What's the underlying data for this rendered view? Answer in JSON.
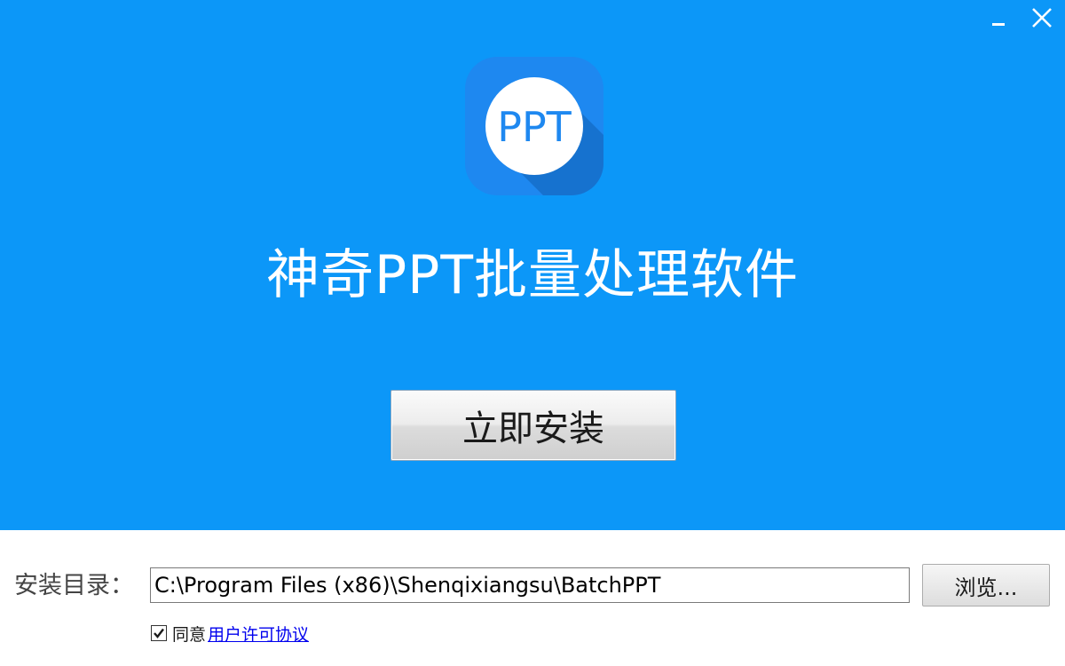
{
  "window": {
    "title": "神奇PPT批量处理软件",
    "minimize_icon": "minimize-icon",
    "close_icon": "close-icon"
  },
  "logo": {
    "text": "PPT",
    "icon": "ppt-app-logo"
  },
  "install_button": {
    "label": "立即安装"
  },
  "install_dir": {
    "label": "安装目录：",
    "value": "C:\\Program Files (x86)\\Shenqixiangsu\\BatchPPT",
    "browse_label": "浏览..."
  },
  "agreement": {
    "checked": true,
    "prefix": "同意",
    "link_text": "用户许可协议"
  },
  "colors": {
    "hero_background": "#0c97f8",
    "logo_background": "#1e88f0",
    "link": "#0000ee"
  }
}
